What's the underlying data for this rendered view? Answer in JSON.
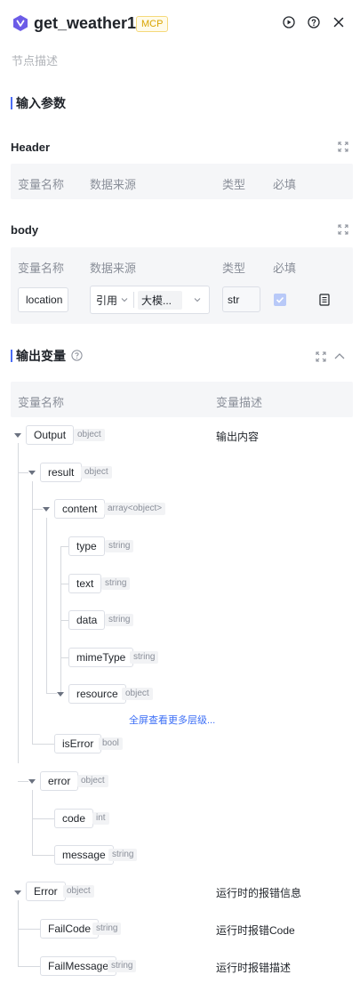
{
  "header": {
    "title": "get_weather1",
    "tag": "MCP",
    "node_desc": "节点描述"
  },
  "input_section": {
    "title": "输入参数"
  },
  "header_block": {
    "title": "Header",
    "columns": [
      "变量名称",
      "数据来源",
      "类型",
      "必填"
    ]
  },
  "body_block": {
    "title": "body",
    "columns": [
      "变量名称",
      "数据来源",
      "类型",
      "必填"
    ],
    "row": {
      "name": "location",
      "source": "引用",
      "value": "大模...",
      "type": "str",
      "required": true
    }
  },
  "output_section": {
    "title": "输出变量",
    "columns": [
      "变量名称",
      "变量描述"
    ],
    "more_link": "全屏查看更多层级...",
    "nodes": [
      {
        "name": "Output",
        "type": "object",
        "desc": "输出内容"
      },
      {
        "name": "result",
        "type": "object",
        "desc": ""
      },
      {
        "name": "content",
        "type": "array<object>",
        "desc": ""
      },
      {
        "name": "type",
        "type": "string",
        "desc": ""
      },
      {
        "name": "text",
        "type": "string",
        "desc": ""
      },
      {
        "name": "data",
        "type": "string",
        "desc": ""
      },
      {
        "name": "mimeType",
        "type": "string",
        "desc": ""
      },
      {
        "name": "resource",
        "type": "object",
        "desc": ""
      },
      {
        "name": "isError",
        "type": "bool",
        "desc": ""
      },
      {
        "name": "error",
        "type": "object",
        "desc": ""
      },
      {
        "name": "code",
        "type": "int",
        "desc": ""
      },
      {
        "name": "message",
        "type": "string",
        "desc": ""
      },
      {
        "name": "Error",
        "type": "object",
        "desc": "运行时的报错信息"
      },
      {
        "name": "FailCode",
        "type": "string",
        "desc": "运行时报错Code"
      },
      {
        "name": "FailMessage",
        "type": "string",
        "desc": "运行时报错描述"
      }
    ]
  }
}
